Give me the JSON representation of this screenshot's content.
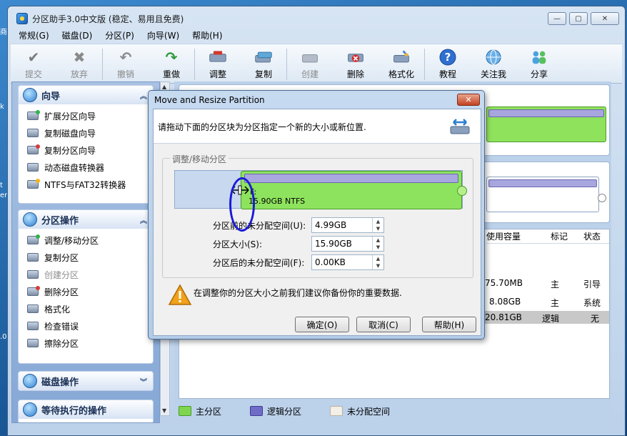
{
  "window": {
    "title": "分区助手3.0中文版 (稳定、易用且免费)"
  },
  "caption": {
    "minimize": "▭",
    "maximize": "▢",
    "close": "✕"
  },
  "menu": [
    "常规(G)",
    "磁盘(D)",
    "分区(P)",
    "向导(W)",
    "帮助(H)"
  ],
  "toolbar": [
    {
      "label": "提交",
      "icon": "check-icon",
      "disabled": true
    },
    {
      "label": "放弃",
      "icon": "x-icon",
      "disabled": true
    },
    {
      "label": "撤销",
      "icon": "undo-icon",
      "disabled": true
    },
    {
      "label": "重做",
      "icon": "redo-icon",
      "disabled": false
    },
    {
      "label": "调整",
      "icon": "resize-disk-icon",
      "disabled": false
    },
    {
      "label": "复制",
      "icon": "copy-disk-icon",
      "disabled": false
    },
    {
      "label": "创建",
      "icon": "create-disk-icon",
      "disabled": true
    },
    {
      "label": "删除",
      "icon": "delete-disk-icon",
      "disabled": false
    },
    {
      "label": "格式化",
      "icon": "format-disk-icon",
      "disabled": false
    },
    {
      "label": "教程",
      "icon": "help-question-icon",
      "disabled": false
    },
    {
      "label": "关注我",
      "icon": "follow-globe-icon",
      "disabled": false
    },
    {
      "label": "分享",
      "icon": "share-people-icon",
      "disabled": false
    }
  ],
  "wizard_panel": {
    "title": "向导",
    "items": [
      "扩展分区向导",
      "复制磁盘向导",
      "复制分区向导",
      "动态磁盘转换器",
      "NTFS与FAT32转换器"
    ]
  },
  "partition_panel": {
    "title": "分区操作",
    "items": [
      {
        "label": "调整/移动分区",
        "disabled": false
      },
      {
        "label": "复制分区",
        "disabled": false
      },
      {
        "label": "创建分区",
        "disabled": true
      },
      {
        "label": "删除分区",
        "disabled": false
      },
      {
        "label": "格式化",
        "disabled": false
      },
      {
        "label": "检查错误",
        "disabled": false
      },
      {
        "label": "擦除分区",
        "disabled": false
      }
    ]
  },
  "disk_panel": {
    "title": "磁盘操作"
  },
  "pending_panel": {
    "title": "等待执行的操作"
  },
  "table": {
    "headers": {
      "used": "使用容量",
      "flag": "标记",
      "status": "状态"
    },
    "rows": [
      {
        "used": "75.70MB",
        "flag": "主",
        "status": "引导"
      },
      {
        "used": "8.08GB",
        "flag": "主",
        "status": "系统"
      },
      {
        "used": "20.81GB",
        "flag": "逻辑",
        "status": "无"
      }
    ]
  },
  "legend": [
    {
      "label": "主分区",
      "color": "#7fd64e"
    },
    {
      "label": "逻辑分区",
      "color": "#6f6cc7"
    },
    {
      "label": "未分配空间",
      "color": "#f3efe6"
    }
  ],
  "dialog": {
    "title": "Move and Resize Partition",
    "close": "✕",
    "instruction": "请拖动下面的分区块为分区指定一个新的大小或新位置.",
    "group_title": "调整/移动分区",
    "partition_letter": "F:",
    "partition_info": "15.90GB NTFS",
    "fields": [
      {
        "label": "分区前的未分配空间(U):",
        "value": "4.99GB"
      },
      {
        "label": "分区大小(S):",
        "value": "15.90GB"
      },
      {
        "label": "分区后的未分配空间(F):",
        "value": "0.00KB"
      }
    ],
    "warning": "在调整你的分区大小之前我们建议你备份你的重要数据.",
    "buttons": {
      "ok": "确定(O)",
      "cancel": "取消(C)",
      "help": "帮助(H)"
    }
  },
  "desktop_fragments": [
    "商",
    "k",
    "t",
    "er",
    ".0"
  ]
}
